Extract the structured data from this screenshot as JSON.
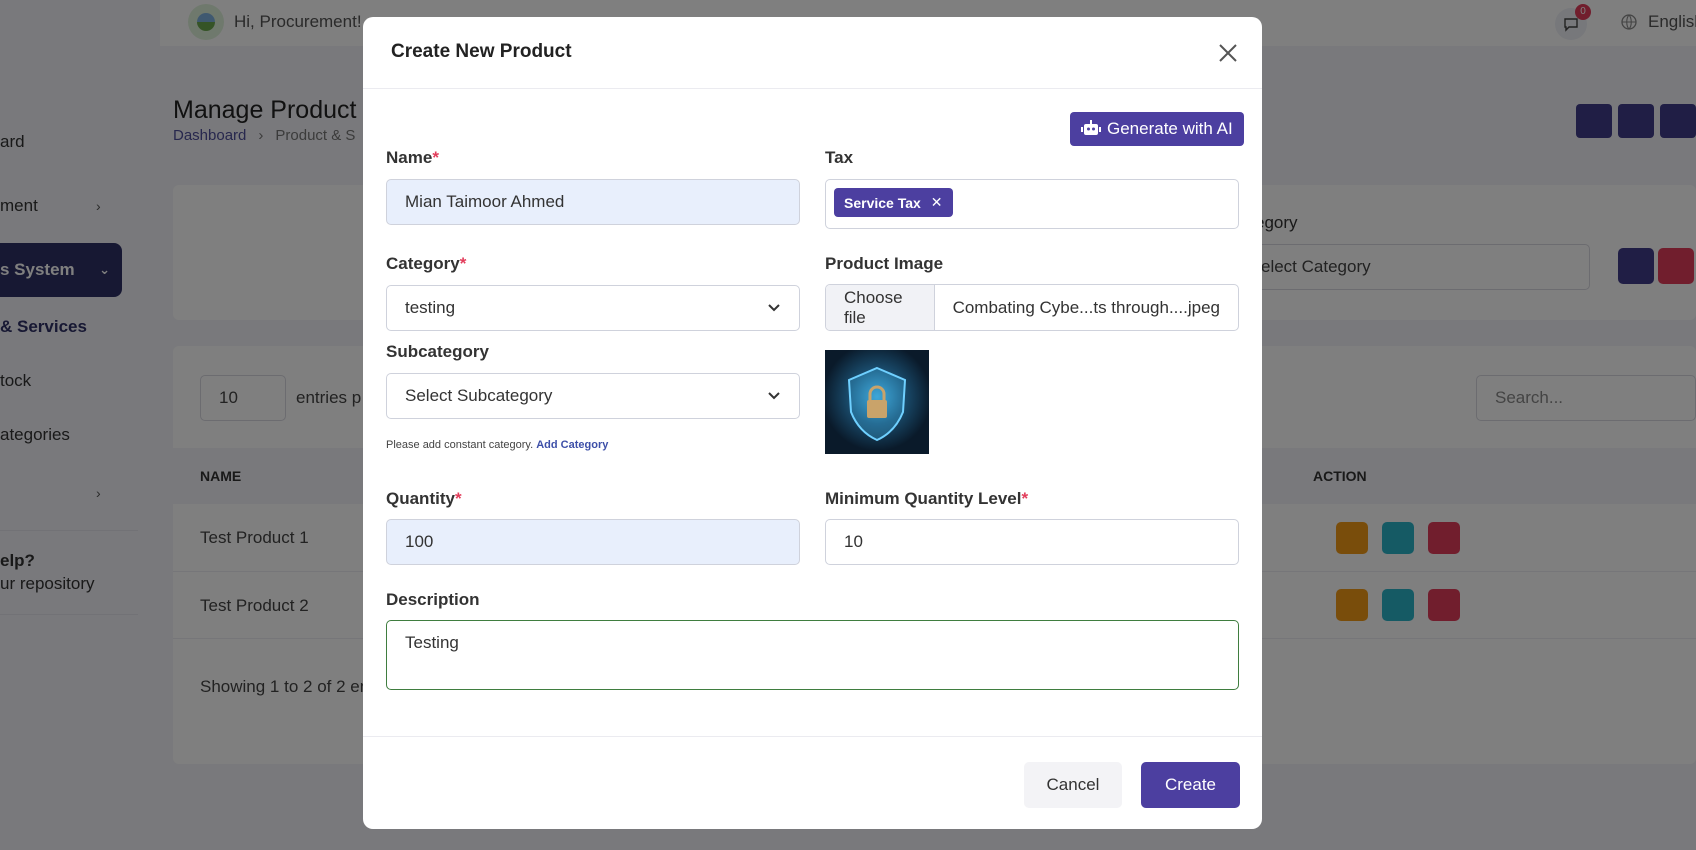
{
  "header": {
    "greeting": "Hi, Procurement!",
    "notification_count": "0",
    "language": "English"
  },
  "sidebar": {
    "items": [
      {
        "label": "ard"
      },
      {
        "label": "ment"
      },
      {
        "label": "s System"
      },
      {
        "label": "& Services"
      },
      {
        "label": "tock"
      },
      {
        "label": "ategories"
      },
      {
        "label": ""
      }
    ],
    "help_title": "elp?",
    "help_sub": "ur repository"
  },
  "page": {
    "title": "Manage Product &",
    "breadcrumb": [
      "Dashboard",
      "Product & S"
    ]
  },
  "filter": {
    "category_label": "egory",
    "category_placeholder": "elect Category"
  },
  "table": {
    "length_value": "10",
    "length_text": "entries p",
    "search_placeholder": "Search...",
    "headers": [
      "NAME",
      "ACTION"
    ],
    "rows": [
      {
        "name": "Test Product 1"
      },
      {
        "name": "Test Product 2"
      }
    ],
    "showing": "Showing 1 to 2 of 2 en"
  },
  "modal": {
    "title": "Create New Product",
    "ai_button": "Generate with AI",
    "name_label": "Name",
    "name_value": "Mian Taimoor Ahmed",
    "tax_label": "Tax",
    "tax_chip": "Service Tax",
    "category_label": "Category",
    "category_value": "testing",
    "image_label": "Product Image",
    "choose_file": "Choose file",
    "file_name": "Combating Cybe...ts through....jpeg",
    "subcategory_label": "Subcategory",
    "subcategory_placeholder": "Select Subcategory",
    "hint_text": "Please add constant category.",
    "hint_link": "Add Category",
    "quantity_label": "Quantity",
    "quantity_value": "100",
    "min_qty_label": "Minimum Quantity Level",
    "min_qty_value": "10",
    "description_label": "Description",
    "description_value": "Testing",
    "required_mark": "*",
    "cancel": "Cancel",
    "create": "Create"
  },
  "colors": {
    "accent": "#4c3fa0",
    "danger": "#e23c5a",
    "sidebar_active": "#2f3067",
    "warning": "#f29a16",
    "info": "#2bb4c9"
  }
}
